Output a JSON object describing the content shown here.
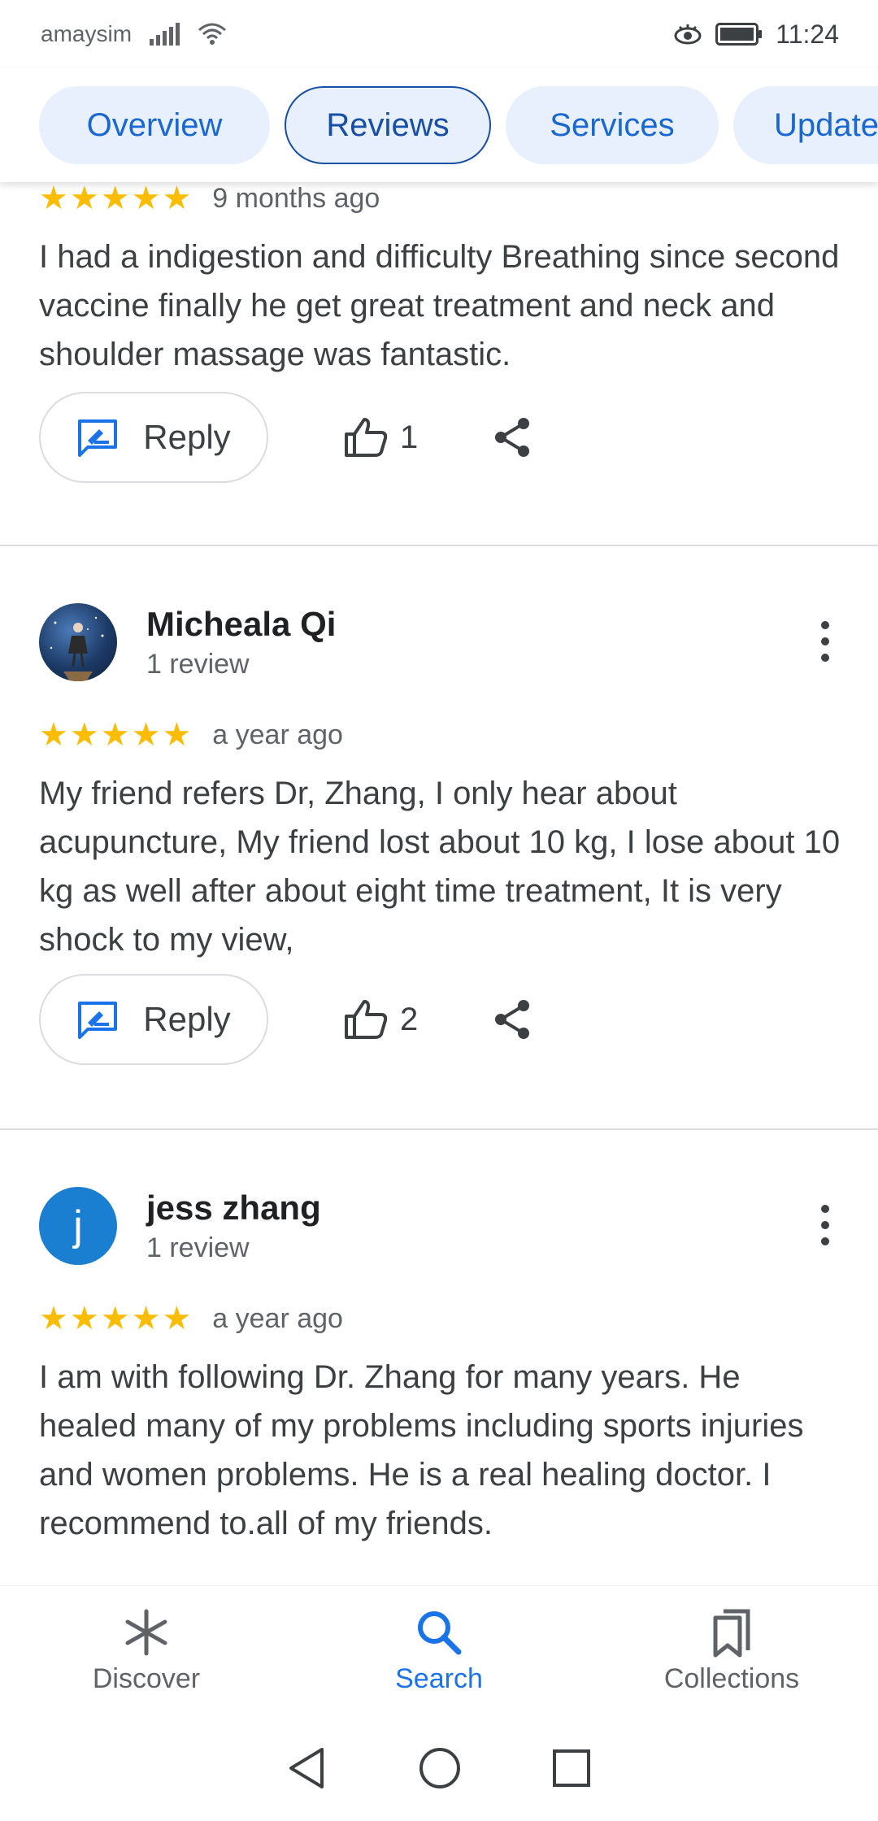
{
  "status_bar": {
    "carrier": "amaysim",
    "time": "11:24"
  },
  "tabs": [
    {
      "label": "Overview",
      "active": false
    },
    {
      "label": "Reviews",
      "active": true
    },
    {
      "label": "Services",
      "active": false
    },
    {
      "label": "Updates",
      "active": false
    }
  ],
  "reviews": [
    {
      "stars": "★★★★★",
      "rating": 5,
      "time_ago": "9 months ago",
      "text": "I had a indigestion and difficulty Breathing since second vaccine finally he get great treatment and neck and shoulder massage was fantastic.",
      "reply_label": "Reply",
      "likes": "1"
    },
    {
      "author": "Micheala Qi",
      "review_count": "1 review",
      "stars": "★★★★★",
      "rating": 5,
      "time_ago": "a year ago",
      "text": "My friend refers Dr, Zhang, I only hear about acupuncture, My friend lost about 10 kg, I lose about 10 kg as well after about eight time treatment, It is very shock to my view,",
      "reply_label": "Reply",
      "likes": "2"
    },
    {
      "author": "jess zhang",
      "avatar_letter": "j",
      "avatar_color": "#1a7fd0",
      "review_count": "1 review",
      "stars": "★★★★★",
      "rating": 5,
      "time_ago": "a year ago",
      "text": "I am with following Dr. Zhang for many years. He healed many of my problems including sports injuries and women problems. He is a real healing doctor. I recommend to.all of my friends."
    }
  ],
  "bottom_nav": [
    {
      "label": "Discover",
      "icon": "asterisk-icon",
      "active": false
    },
    {
      "label": "Search",
      "icon": "search-icon",
      "active": true
    },
    {
      "label": "Collections",
      "icon": "bookmarks-icon",
      "active": false
    }
  ],
  "colors": {
    "accent": "#1a73e8",
    "star": "#fbbc04"
  }
}
